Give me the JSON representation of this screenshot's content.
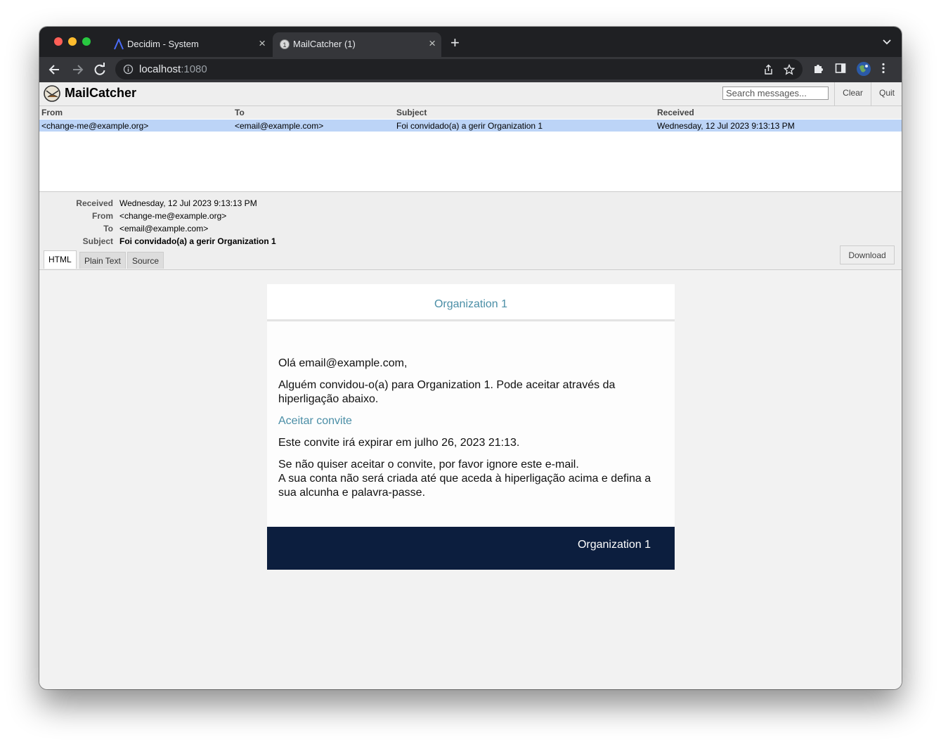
{
  "browser": {
    "tabs": [
      {
        "title": "Decidim - System",
        "active": false
      },
      {
        "title": "MailCatcher (1)",
        "active": true
      }
    ],
    "url_host": "localhost",
    "url_port": ":1080"
  },
  "mailcatcher": {
    "title": "MailCatcher",
    "search_placeholder": "Search messages...",
    "clear_label": "Clear",
    "quit_label": "Quit",
    "columns": [
      "From",
      "To",
      "Subject",
      "Received"
    ],
    "messages": [
      {
        "from": "<change-me@example.org>",
        "to": "<email@example.com>",
        "subject": "Foi convidado(a) a gerir Organization 1",
        "received": "Wednesday, 12 Jul 2023 9:13:13 PM"
      }
    ]
  },
  "detail": {
    "labels": {
      "received": "Received",
      "from": "From",
      "to": "To",
      "subject": "Subject"
    },
    "received": "Wednesday, 12 Jul 2023 9:13:13 PM",
    "from": "<change-me@example.org>",
    "to": "<email@example.com>",
    "subject": "Foi convidado(a) a gerir Organization 1",
    "format_tabs": [
      "HTML",
      "Plain Text",
      "Source"
    ],
    "active_format": "HTML",
    "download_label": "Download"
  },
  "email": {
    "header_org": "Organization 1",
    "greeting": "Olá email@example.com,",
    "intro": "Alguém convidou-o(a) para Organization 1. Pode aceitar através da hiperligação abaixo.",
    "accept_link": "Aceitar convite",
    "expiry": "Este convite irá expirar em julho 26, 2023 21:13.",
    "ignore_line1": "Se não quiser aceitar o convite, por favor ignore este e-mail.",
    "ignore_line2": "A sua conta não será criada até que aceda à hiperligação acima e defina a sua alcunha e palavra-passe.",
    "footer_org": "Organization 1",
    "link_color": "#4a8ea6",
    "footer_color": "#0c1e3e"
  }
}
